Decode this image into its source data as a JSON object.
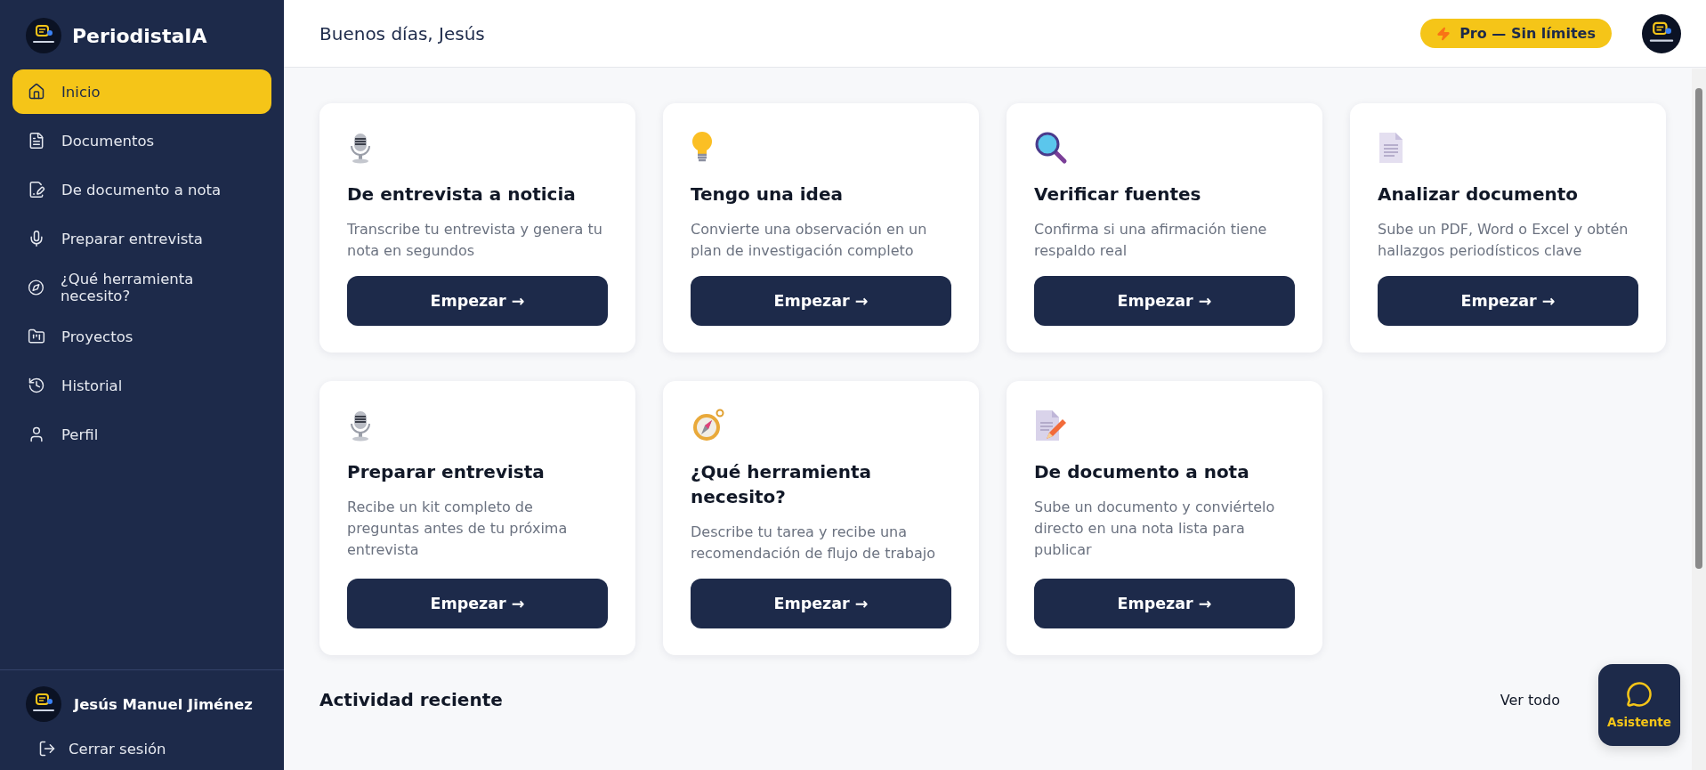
{
  "sidebar": {
    "brand": "PeriodistaIA",
    "items": [
      {
        "label": "Inicio",
        "selected": true
      },
      {
        "label": "Documentos",
        "selected": false
      },
      {
        "label": "De documento a nota",
        "selected": false
      },
      {
        "label": "Preparar entrevista",
        "selected": false
      },
      {
        "label": "¿Qué herramienta necesito?",
        "selected": false
      },
      {
        "label": "Proyectos",
        "selected": false
      },
      {
        "label": "Historial",
        "selected": false
      },
      {
        "label": "Perfil",
        "selected": false
      }
    ],
    "user": {
      "name": "Jesús Manuel Jiménez"
    },
    "logout": "Cerrar sesión"
  },
  "header": {
    "greeting": "Buenos días, Jesús",
    "plan_badge": "Pro — Sin límites"
  },
  "cards": [
    {
      "title": "De entrevista a noticia",
      "description": "Transcribe tu entrevista y genera tu nota en segundos",
      "button": "Empezar →"
    },
    {
      "title": "Tengo una idea",
      "description": "Convierte una observación en un plan de investigación completo",
      "button": "Empezar →"
    },
    {
      "title": "Verificar fuentes",
      "description": "Confirma si una afirmación tiene respaldo real",
      "button": "Empezar →"
    },
    {
      "title": "Analizar documento",
      "description": "Sube un PDF, Word o Excel y obtén hallazgos periodísticos clave",
      "button": "Empezar →"
    },
    {
      "title": "Preparar entrevista",
      "description": "Recibe un kit completo de preguntas antes de tu próxima entrevista",
      "button": "Empezar →"
    },
    {
      "title": "¿Qué herramienta necesito?",
      "description": "Describe tu tarea y recibe una recomendación de flujo de trabajo",
      "button": "Empezar →"
    },
    {
      "title": "De documento a nota",
      "description": "Sube un documento y conviértelo directo en una nota lista para publicar",
      "button": "Empezar →"
    }
  ],
  "recent": {
    "title": "Actividad reciente",
    "link": "Ver todo"
  },
  "assistant_button": "Asistente"
}
